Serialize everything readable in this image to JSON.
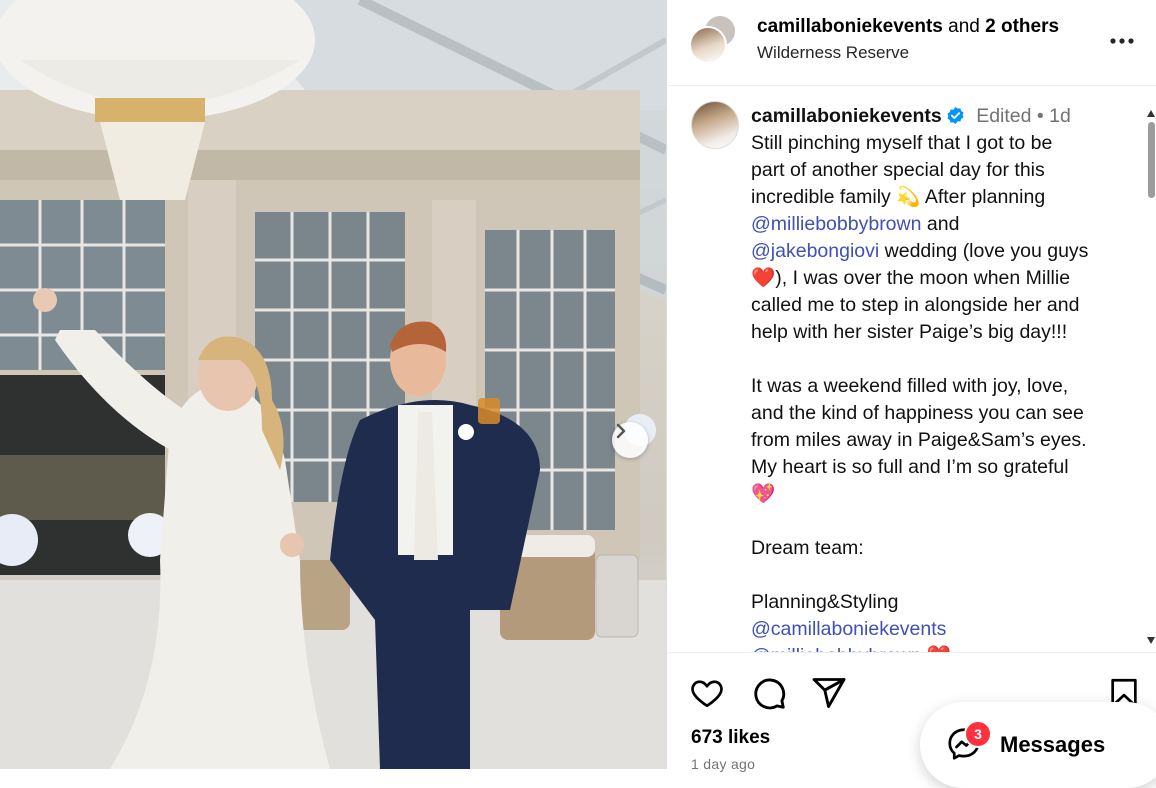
{
  "post": {
    "header": {
      "username": "camillaboniekevents",
      "and_text": " and ",
      "others_text": "2 others",
      "location": "Wilderness Reserve"
    },
    "caption": {
      "username": "camillaboniekevents",
      "edited": "Edited",
      "dot": " • ",
      "time": "1d",
      "lines": {
        "l1": "Still pinching myself that I got to be",
        "l2": "part of another special day for this",
        "l3": "incredible family 💫 After planning",
        "m1": "@milliebobbybrown",
        "l4": " and",
        "m2": "@jakebongiovi",
        "l5": " wedding (love you guys",
        "l6": "❤️), I was over the moon when Millie",
        "l7": "called me to step in alongside her and",
        "l8": "help with her sister Paige’s big day!!!",
        "l9": "It was a weekend filled with joy, love,",
        "l10": "and the kind of happiness you can see",
        "l11": "from miles away in Paige&Sam’s eyes.",
        "l12": "My heart is so full and I’m so grateful",
        "l13": "💖",
        "l14": "Dream team:",
        "l15": "Planning&Styling",
        "m3": "@camillaboniekevents",
        "m4": "@milliebobbybrown ❤️"
      }
    },
    "likes": "673 likes",
    "posted_ago": "1 day ago"
  },
  "messages": {
    "label": "Messages",
    "badge_count": "3"
  },
  "icons": {
    "more": "more-options-icon",
    "like": "heart-icon",
    "comment": "comment-icon",
    "share": "share-icon",
    "save": "bookmark-icon",
    "verified": "verified-badge-icon",
    "next": "chevron-right-icon",
    "messenger": "messenger-icon"
  },
  "colors": {
    "mention": "#4050b5",
    "verified": "#0095f6",
    "badge": "#ff3040",
    "meta": "#737373"
  }
}
